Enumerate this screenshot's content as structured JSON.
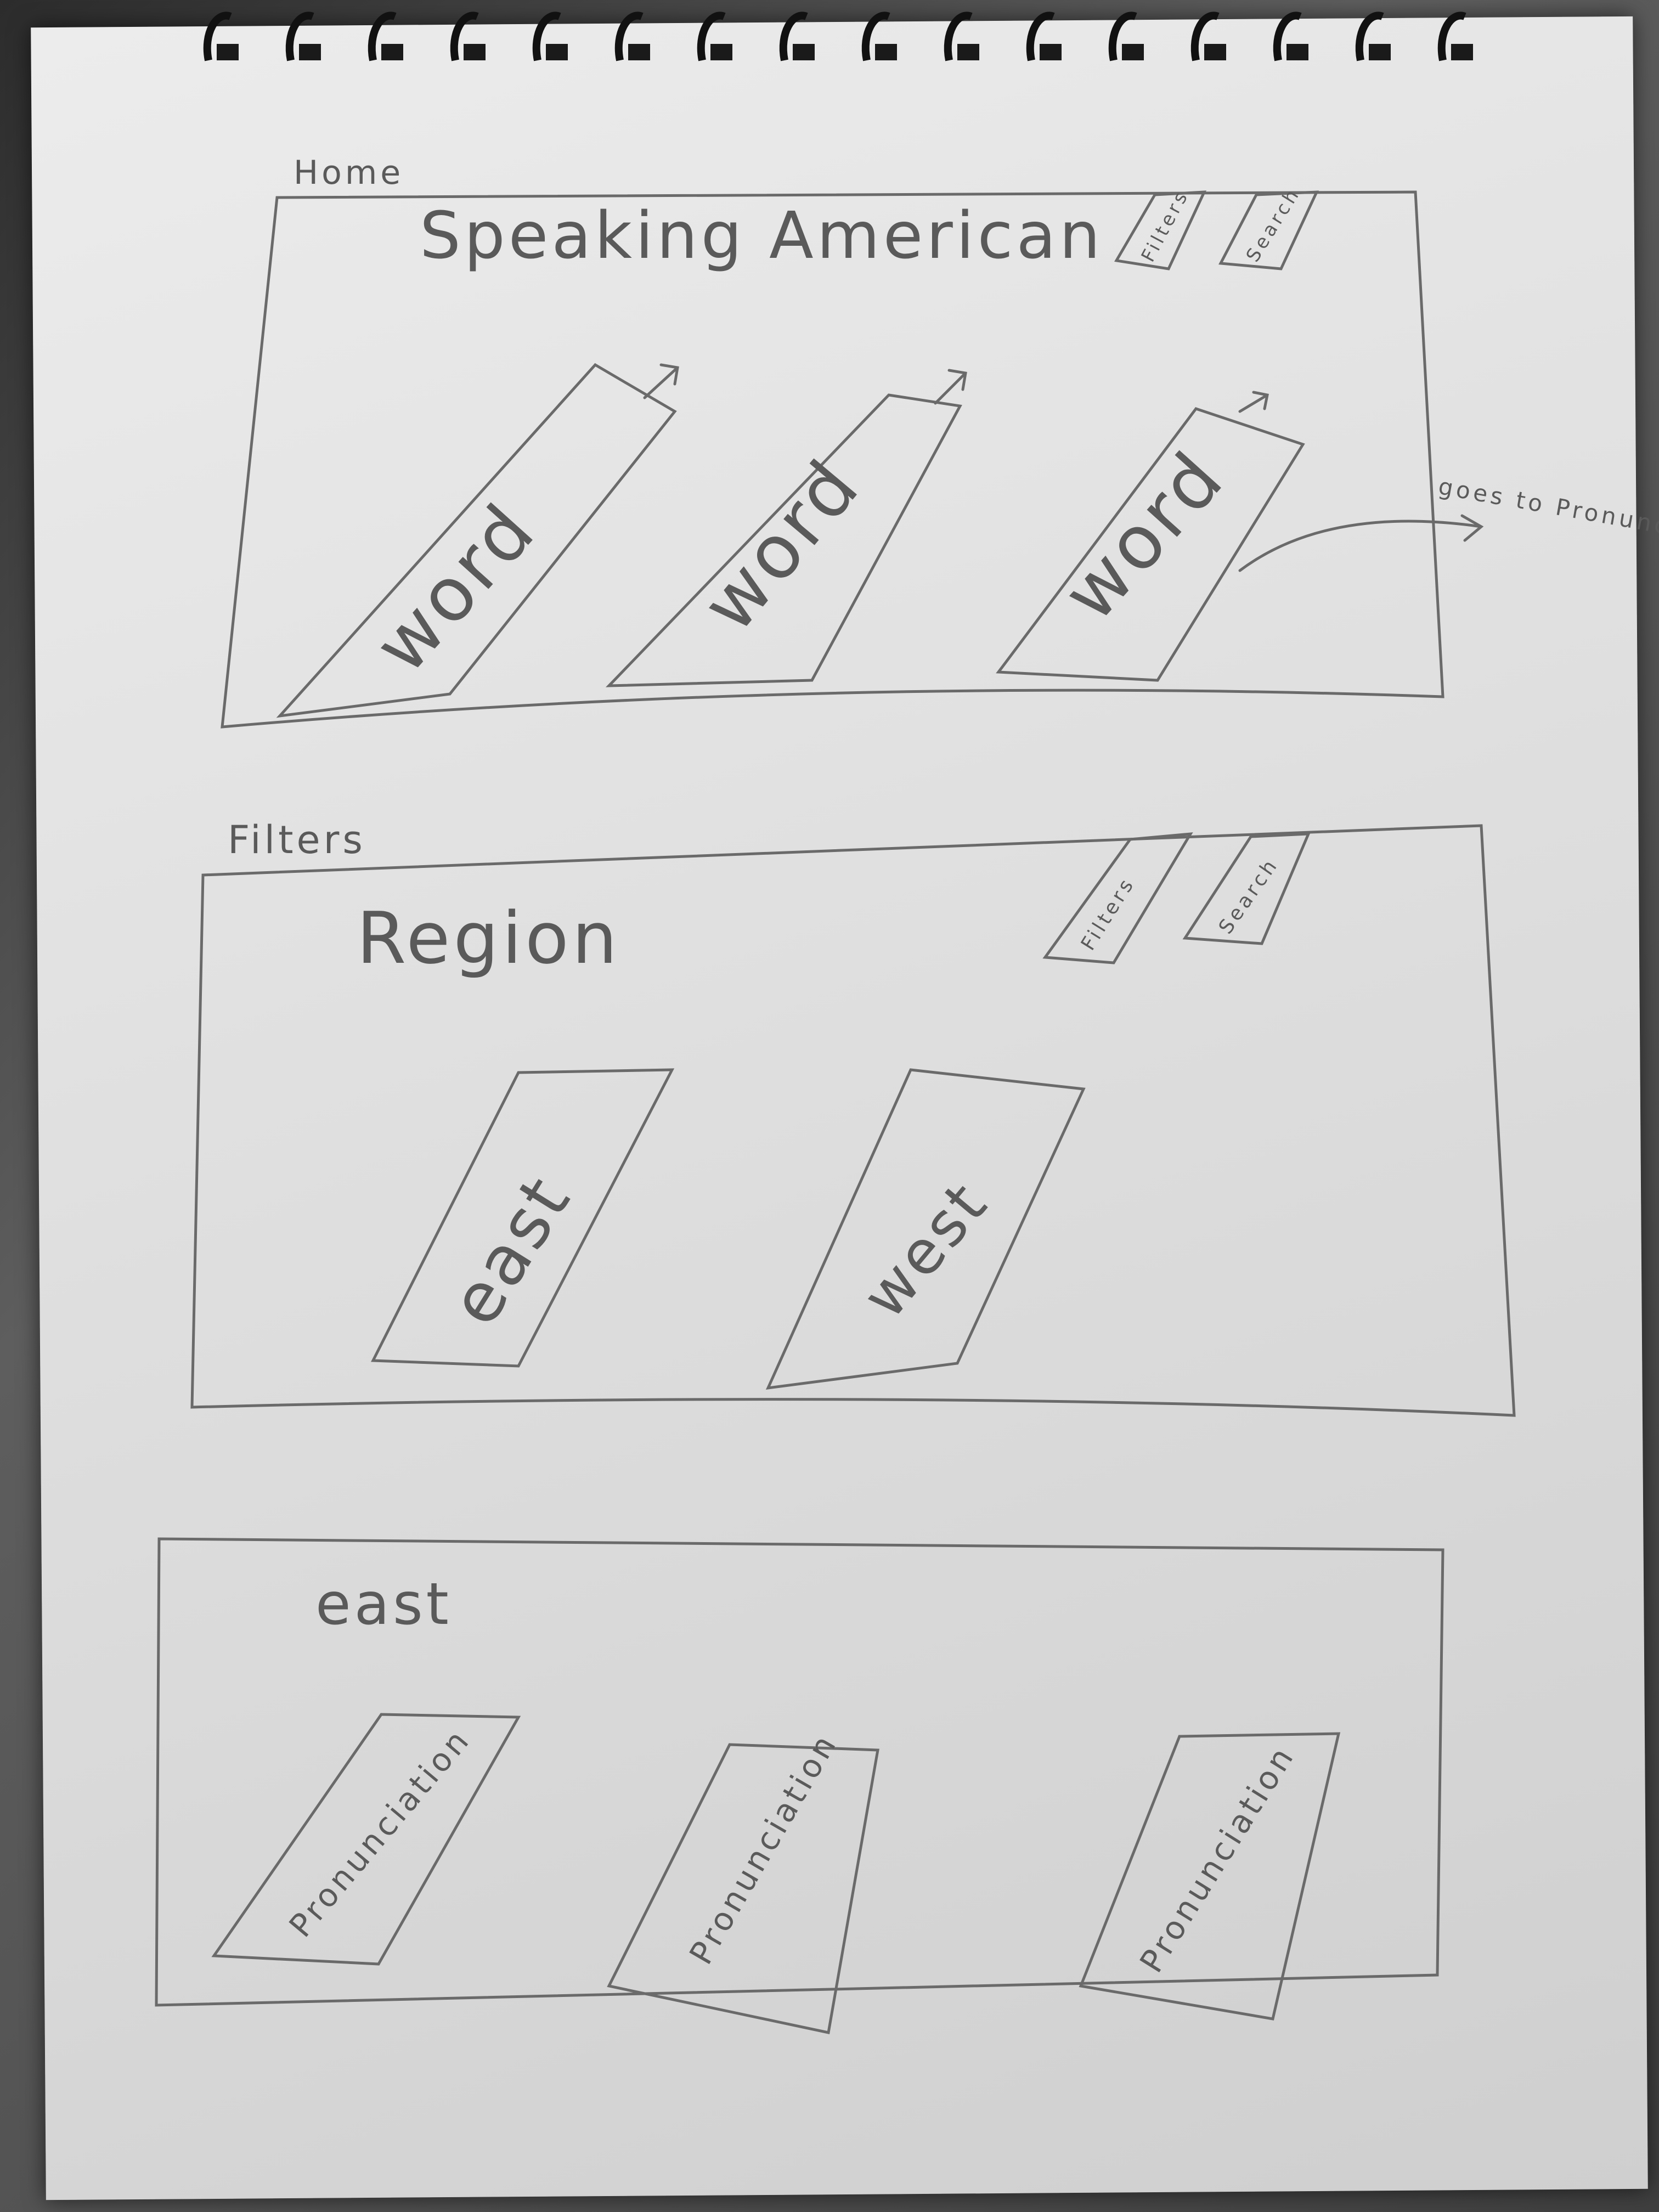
{
  "home": {
    "frame_label": "Home",
    "title": "Speaking American",
    "filters_button": "Filters",
    "search_button": "Search",
    "word_cards": [
      "word",
      "word",
      "word"
    ],
    "annotation": "goes to Pronunciation"
  },
  "filters": {
    "frame_label": "Filters",
    "heading": "Region",
    "filters_button": "Filters",
    "search_button": "Search",
    "region_cards": [
      "east",
      "west"
    ]
  },
  "east": {
    "heading": "east",
    "pronunciation_cards": [
      "Pronunciation",
      "Pronunciation",
      "Pronunciation"
    ]
  }
}
